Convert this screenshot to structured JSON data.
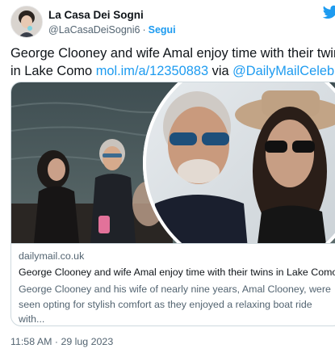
{
  "header": {
    "account_name": "La Casa Dei Sogni",
    "handle": "@LaCasaDeiSogni6",
    "separator": "·",
    "follow_label": "Segui"
  },
  "tweet": {
    "text_line1": "George Clooney and wife Amal enjoy time with their twins",
    "text_line2_prefix": "in Lake Como ",
    "link": "mol.im/a/12350883",
    "via": " via ",
    "mention": "@DailyMailCeleb"
  },
  "card": {
    "domain": "dailymail.co.uk",
    "title": "George Clooney and wife Amal enjoy time with their twins in Lake Como",
    "description": "George Clooney and his wife of nearly nine years, Amal Clooney, were seen opting for stylish comfort as they enjoyed a relaxing boat ride with..."
  },
  "footer": {
    "timestamp": "11:58 AM · 29 lug 2023"
  },
  "colors": {
    "accent": "#1d9bf0",
    "text": "#0f1419",
    "secondary_text": "#536471",
    "border": "#cfd9de"
  },
  "icons": {
    "brand": "twitter-bird-icon",
    "avatar": "profile-avatar"
  }
}
